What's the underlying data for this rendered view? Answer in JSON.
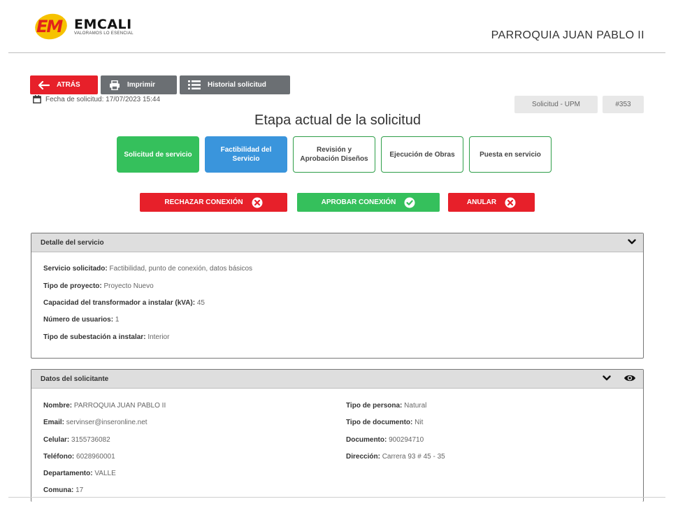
{
  "header": {
    "logo_name": "EMCALI",
    "logo_em": "EM",
    "logo_tagline": "VALORAMOS LO ESENCIAL",
    "title": "PARROQUIA JUAN PABLO II"
  },
  "toolbar": {
    "back_label": "ATRÁS",
    "print_label": "Imprimir",
    "history_label": "Historial solicitud"
  },
  "request": {
    "date_text": "Fecha de solicitud: 17/07/2023 15:44",
    "type_chip": "Solicitud - UPM",
    "number_chip": "#353"
  },
  "stage": {
    "title": "Etapa actual de la solicitud",
    "steps": [
      {
        "label": "Solicitud de servicio",
        "state": "done"
      },
      {
        "label": "Factibilidad del Servicio",
        "state": "current"
      },
      {
        "label": "Revisión y Aprobación Diseños",
        "state": "pending"
      },
      {
        "label": "Ejecución de Obras",
        "state": "pending"
      },
      {
        "label": "Puesta en servicio",
        "state": "pending"
      }
    ]
  },
  "actions": {
    "reject_label": "RECHAZAR CONEXIÓN",
    "approve_label": "APROBAR CONEXIÓN",
    "cancel_label": "ANULAR"
  },
  "service_detail": {
    "title": "Detalle del servicio",
    "fields": [
      {
        "label": "Servicio solicitado:",
        "value": "Factibilidad, punto de conexión, datos básicos"
      },
      {
        "label": "Tipo de proyecto:",
        "value": "Proyecto Nuevo"
      },
      {
        "label": "Capacidad del transformador a instalar (kVA):",
        "value": "45"
      },
      {
        "label": "Número de usuarios:",
        "value": "1"
      },
      {
        "label": "Tipo de subestación a instalar:",
        "value": "Interior"
      }
    ]
  },
  "applicant": {
    "title": "Datos del solicitante",
    "left": [
      {
        "label": "Nombre:",
        "value": "PARROQUIA JUAN PABLO II"
      },
      {
        "label": "Email:",
        "value": "servinser@inseronline.net"
      },
      {
        "label": "Celular:",
        "value": "3155736082"
      },
      {
        "label": "Teléfono:",
        "value": "6028960001"
      },
      {
        "label": "Departamento:",
        "value": "VALLE"
      },
      {
        "label": "Comuna:",
        "value": "17"
      }
    ],
    "right": [
      {
        "label": "Tipo de persona:",
        "value": "Natural"
      },
      {
        "label": "Tipo de documento:",
        "value": "Nit"
      },
      {
        "label": "Documento:",
        "value": "900294710"
      },
      {
        "label": "Dirección:",
        "value": "Carrera 93 # 45 - 35"
      }
    ]
  },
  "colors": {
    "red": "#e7202a",
    "green": "#35c05c",
    "blue": "#3a95dc",
    "gray_button": "#6b6f73"
  }
}
